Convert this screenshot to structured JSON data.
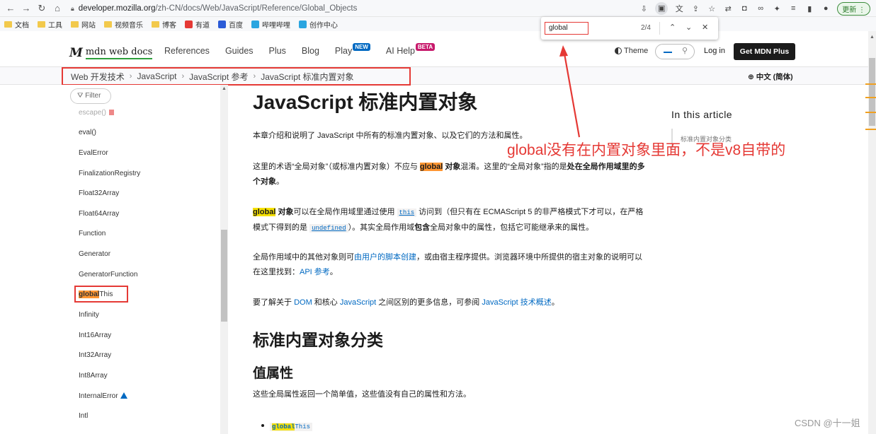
{
  "browser": {
    "url_host": "developer.mozilla.org",
    "url_path": "/zh-CN/docs/Web/JavaScript/Reference/Global_Objects",
    "update_label": "更新"
  },
  "bookmarks": [
    {
      "label": "文档",
      "kind": "folder"
    },
    {
      "label": "工具",
      "kind": "folder"
    },
    {
      "label": "网站",
      "kind": "folder"
    },
    {
      "label": "视频音乐",
      "kind": "folder"
    },
    {
      "label": "博客",
      "kind": "folder"
    },
    {
      "label": "有道",
      "kind": "badge",
      "color": "#e53935"
    },
    {
      "label": "百度",
      "kind": "badge",
      "color": "#2b5bd7"
    },
    {
      "label": "哔哩哔哩",
      "kind": "badge",
      "color": "#2aa5e0"
    },
    {
      "label": "创作中心",
      "kind": "badge",
      "color": "#2aa5e0"
    }
  ],
  "find_bar": {
    "query": "global",
    "count": "2/4"
  },
  "header": {
    "logo_mark": "M",
    "logo_text": "mdn web docs",
    "nav": [
      "References",
      "Guides",
      "Plus",
      "Blog",
      "Play",
      "AI Help"
    ],
    "badge_new": "NEW",
    "badge_beta": "BETA",
    "theme": "Theme",
    "login": "Log in",
    "get_plus": "Get MDN Plus"
  },
  "breadcrumb": [
    "Web 开发技术",
    "JavaScript",
    "JavaScript 参考",
    "JavaScript 标准内置对象"
  ],
  "language": "中文 (简体)",
  "sidebar": {
    "filter": "Filter",
    "items": [
      "escape()",
      "eval()",
      "EvalError",
      "FinalizationRegistry",
      "Float32Array",
      "Float64Array",
      "Function",
      "Generator",
      "GeneratorFunction",
      "globalThis",
      "Infinity",
      "Int16Array",
      "Int32Array",
      "Int8Array",
      "InternalError",
      "Intl"
    ],
    "highlight_term": "global",
    "highlight_rest": "This"
  },
  "main": {
    "title": "JavaScript 标准内置对象",
    "p1": "本章介绍和说明了 JavaScript 中所有的标准内置对象、以及它们的方法和属性。",
    "p2_a": "这里的术语“全局对象”（或标准内置对象）不应与 ",
    "p2_hl": "global",
    "p2_b": " 对象",
    "p2_c": "混淆。这里的“全局对象”指的是",
    "p2_d": "处在全局作用域里的多个对象",
    "p2_e": "。",
    "p3_hl": "global",
    "p3_a": " 对象",
    "p3_b": "可以在全局作用域里通过使用 ",
    "p3_code1": "this",
    "p3_c": " 访问到（但只有在 ECMAScript 5 的非严格模式下才可以，在严格模式下得到的是 ",
    "p3_code2": "undefined",
    "p3_d": "）。其实全局作用域",
    "p3_e": "包含",
    "p3_f": "全局对象中的属性，包括它可能继承来的属性。",
    "p4_a": "全局作用域中的其他对象则可",
    "p4_link": "由用户的脚本创建",
    "p4_b": "，或由宿主程序提供。浏览器环境中所提供的宿主对象的说明可以在这里找到：",
    "p4_link2": "API 参考",
    "p4_c": "。",
    "p5_a": "要了解关于 ",
    "p5_link1": "DOM",
    "p5_b": " 和核心 ",
    "p5_link2": "JavaScript",
    "p5_c": " 之间区别的更多信息，可参阅 ",
    "p5_link3": "JavaScript 技术概述",
    "p5_d": "。",
    "h2": "标准内置对象分类",
    "h3": "值属性",
    "p6": "这些全局属性返回一个简单值，这些值没有自己的属性和方法。",
    "bullet_hl": "global",
    "bullet_rest": "This"
  },
  "toc": {
    "title": "In this article",
    "item": "标准内置对象分类"
  },
  "annotation": "global没有在内置对象里面，不是v8自带的",
  "watermark": "CSDN @十一姐",
  "colors": {
    "annotation_red": "#e53935",
    "link_blue": "#0069c2",
    "highlight_yellow": "#f5e000",
    "highlight_orange": "#ff9632"
  }
}
